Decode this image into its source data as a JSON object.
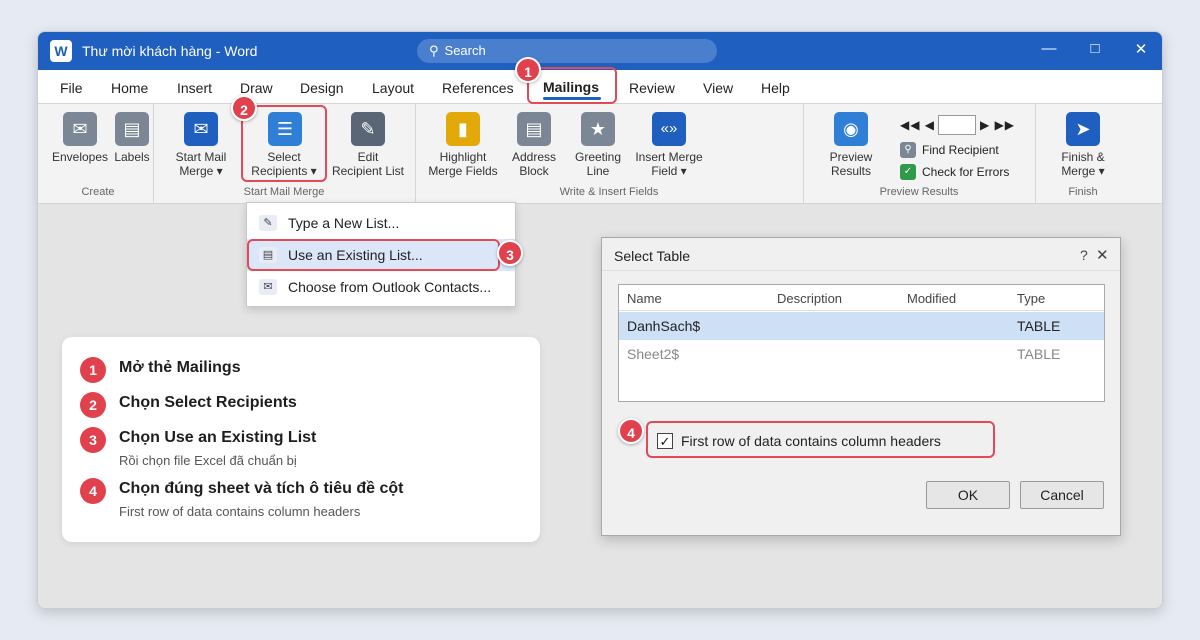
{
  "window": {
    "logo_letter": "W",
    "title": "Thư mời khách hàng - Word",
    "search_placeholder": "Search",
    "minimize": "—",
    "maximize": "□",
    "close": "✕"
  },
  "menu": [
    "File",
    "Home",
    "Insert",
    "Draw",
    "Design",
    "Layout",
    "References",
    "Mailings",
    "Review",
    "View",
    "Help"
  ],
  "ribbon": {
    "create": {
      "label": "Create",
      "envelopes": "Envelopes",
      "labels": "Labels"
    },
    "start_mail_merge": {
      "label": "Start Mail Merge",
      "start_line1": "Start Mail",
      "start_line2": "Merge ▾",
      "select_line1": "Select",
      "select_line2": "Recipients ▾",
      "edit_line1": "Edit",
      "edit_line2": "Recipient List"
    },
    "write_insert": {
      "label": "Write & Insert Fields",
      "highlight_line1": "Highlight",
      "highlight_line2": "Merge Fields",
      "address_line1": "Address",
      "address_line2": "Block",
      "greeting_line1": "Greeting",
      "greeting_line2": "Line",
      "insert_line1": "Insert Merge",
      "insert_line2": "Field ▾"
    },
    "preview": {
      "label": "Preview Results",
      "preview_line1": "Preview",
      "preview_line2": "Results",
      "nav_left": "◀◀ ◀",
      "nav_right": "▶ ▶▶",
      "find_recipient": "Find Recipient",
      "check_errors": "Check for Errors"
    },
    "finish": {
      "label": "Finish",
      "finish_line1": "Finish &",
      "finish_line2": "Merge ▾"
    }
  },
  "dropdown": {
    "items": [
      {
        "icon": "pencil-icon",
        "label": "Type a New List..."
      },
      {
        "icon": "list-icon",
        "label": "Use an Existing List..."
      },
      {
        "icon": "mail-icon",
        "label": "Choose from Outlook Contacts..."
      }
    ]
  },
  "badges": [
    "1",
    "2",
    "3",
    "4"
  ],
  "steps": [
    {
      "num": "1",
      "title": "Mở thẻ Mailings",
      "sub": ""
    },
    {
      "num": "2",
      "title": "Chọn Select Recipients",
      "sub": ""
    },
    {
      "num": "3",
      "title": "Chọn Use an Existing List",
      "sub": "Rồi chọn file Excel đã chuẩn bị"
    },
    {
      "num": "4",
      "title": "Chọn đúng sheet và tích ô tiêu đề cột",
      "sub": "First row of data contains column headers"
    }
  ],
  "dialog": {
    "title": "Select Table",
    "help": "?",
    "close": "✕",
    "columns": [
      "Name",
      "Description",
      "Modified",
      "Type"
    ],
    "rows": [
      {
        "name": "DanhSach$",
        "description": "",
        "modified": "",
        "type": "TABLE"
      },
      {
        "name": "Sheet2$",
        "description": "",
        "modified": "",
        "type": "TABLE"
      }
    ],
    "checkbox_mark": "✓",
    "checkbox_label": "First row of data contains column headers",
    "ok": "OK",
    "cancel": "Cancel"
  },
  "colors": {
    "brand_blue": "#1f5fbf",
    "highlight_red": "#e24a58",
    "selection_blue": "#cde0f6"
  }
}
